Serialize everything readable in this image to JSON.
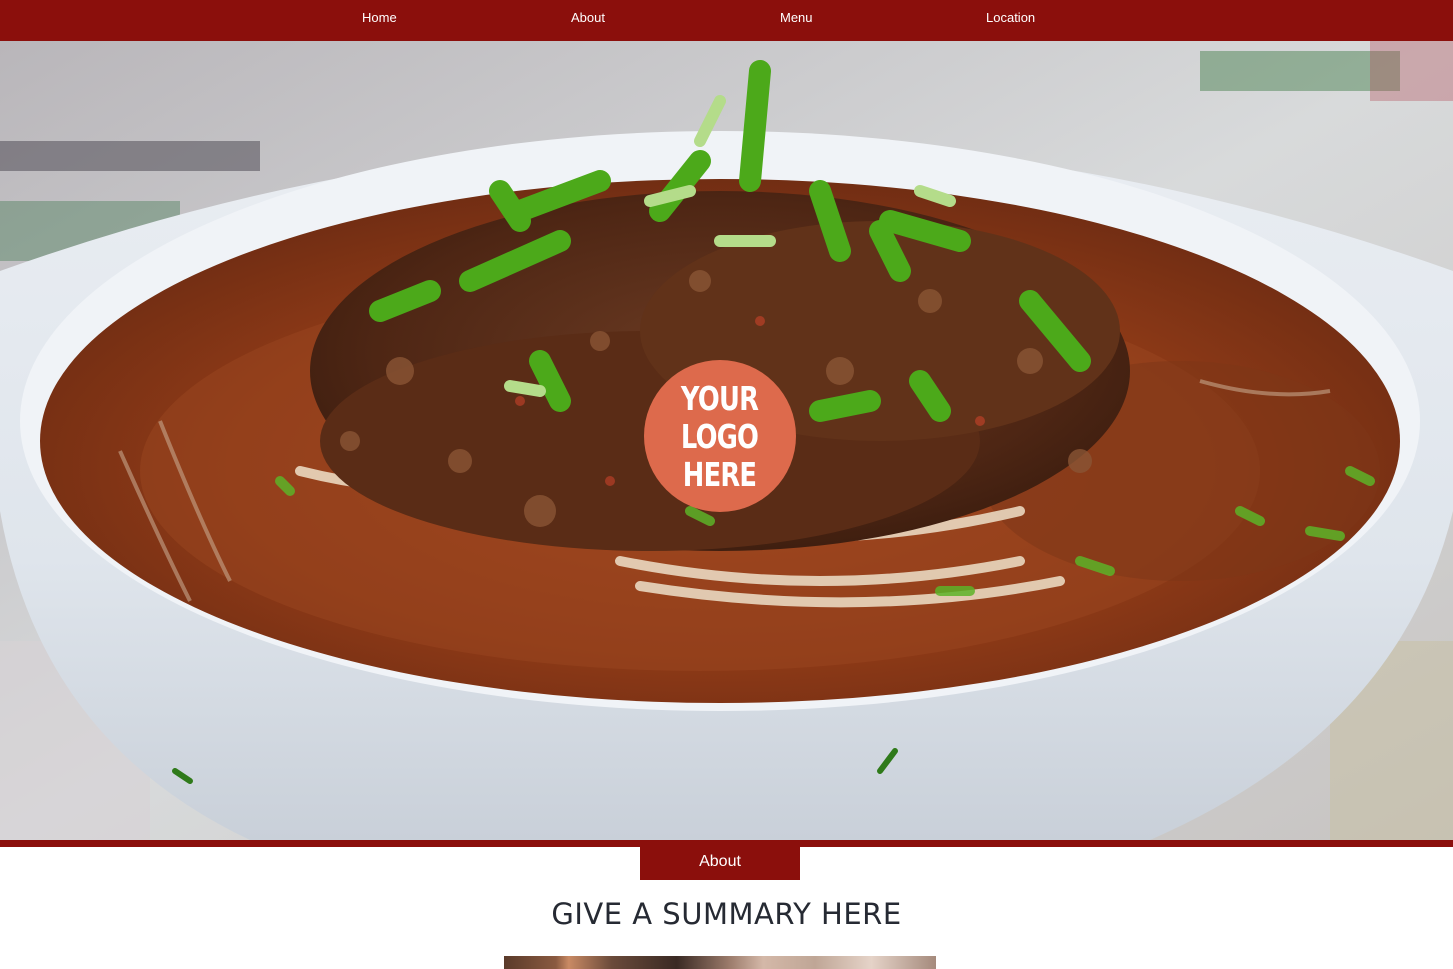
{
  "nav": {
    "items": [
      {
        "label": "Home"
      },
      {
        "label": "About"
      },
      {
        "label": "Menu"
      },
      {
        "label": "Location"
      }
    ]
  },
  "hero": {
    "logo_text": "YOUR\nLOGO\nHERE",
    "logo_color": "#dd6a4c"
  },
  "about": {
    "tab_label": "About",
    "heading": "GIVE A SUMMARY HERE"
  },
  "colors": {
    "brand": "#8b0f0c",
    "heading_text": "#262a33",
    "logo": "#dd6a4c"
  }
}
